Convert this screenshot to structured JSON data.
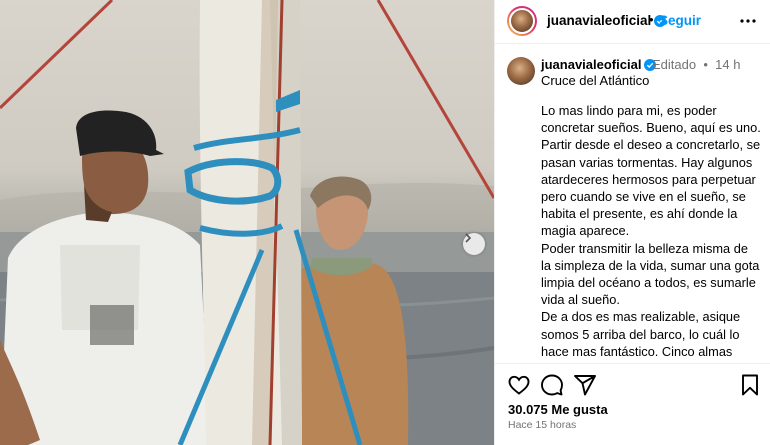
{
  "header": {
    "username": "juanavialeoficial",
    "follow_label": "Seguir"
  },
  "caption": {
    "username": "juanavialeoficial",
    "edited_label": "Editado",
    "age": "14 h",
    "title": "Cruce del Atlántico",
    "paragraphs": [
      "Lo mas lindo para mi, es poder concretar sueños. Bueno, aquí es uno. Partir desde el deseo a concretarlo, se pasan varias tormentas. Hay algunos atardeceres hermosos para perpetuar pero cuando se vive en el sueño, se habita el presente, es ahí donde la magia aparece.",
      "Poder transmitir la belleza misma de la simpleza de la vida, sumar una gota limpia del océano a todos, es sumarle vida al sueño.",
      "De a dos es mas realizable, asique somos 5 arriba del barco, lo cuál lo hace mas fantástico. Cinco almas haciendo de las suyas en singular y en plural... Creo que una vez lo dije, pero lo repito, no se puede cuidar ni amar lo que no se conoce."
    ]
  },
  "engagement": {
    "likes": "30.075 Me gusta",
    "posted": "Hace 15 horas"
  },
  "icons": {
    "verified": "verified-badge-icon",
    "more": "more-options-icon",
    "like": "heart-icon",
    "comment": "comment-icon",
    "share": "paper-plane-icon",
    "save": "bookmark-icon",
    "next": "chevron-right-icon"
  },
  "colors": {
    "link_blue": "#0095f6",
    "verified_blue": "#0095f6",
    "secondary_text": "#737373"
  }
}
